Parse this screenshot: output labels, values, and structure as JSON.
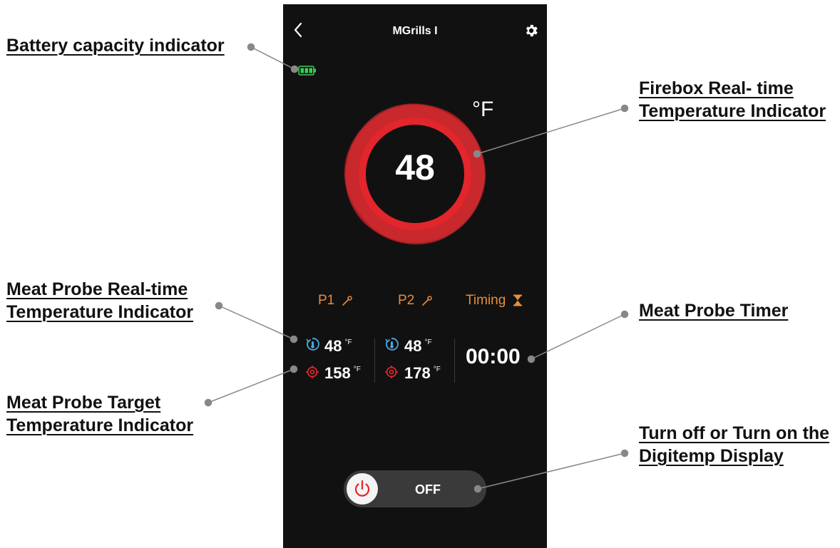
{
  "app": {
    "title": "MGrills I",
    "unit": "°F",
    "firebox_temp": "48",
    "battery_level": 1.0
  },
  "probes": {
    "p1_label": "P1",
    "p2_label": "P2",
    "timing_label": "Timing",
    "p1_real_time": "48",
    "p1_target": "158",
    "p2_real_time": "48",
    "p2_target": "178",
    "degree_unit": "°F",
    "timer": "00:00"
  },
  "display_toggle": {
    "label": "OFF"
  },
  "callouts": {
    "battery": [
      "Battery capacity indicator"
    ],
    "firebox": [
      "Firebox Real- time",
      "Temperature Indicator"
    ],
    "probe_real_time": [
      "Meat Probe Real-time",
      "Temperature Indicator"
    ],
    "probe_target": [
      "Meat Probe Target",
      "Temperature Indicator"
    ],
    "probe_timer": [
      "Meat Probe Timer"
    ],
    "display_toggle": [
      "Turn off or Turn on the",
      "Digitemp Display"
    ]
  },
  "colors": {
    "phone_background": "#111111",
    "accent_red": "#e2262c",
    "probe_label_orange": "#e98d3c",
    "real_time_icon_blue": "#4aa6e0",
    "battery_green": "#3fcc5a",
    "toggle_track": "#3a3a3a"
  },
  "icons": [
    "back-icon",
    "gear-icon",
    "battery-icon",
    "thermometer-probe-icon",
    "hourglass-icon",
    "real-time-thermometer-icon",
    "target-icon",
    "power-icon"
  ]
}
